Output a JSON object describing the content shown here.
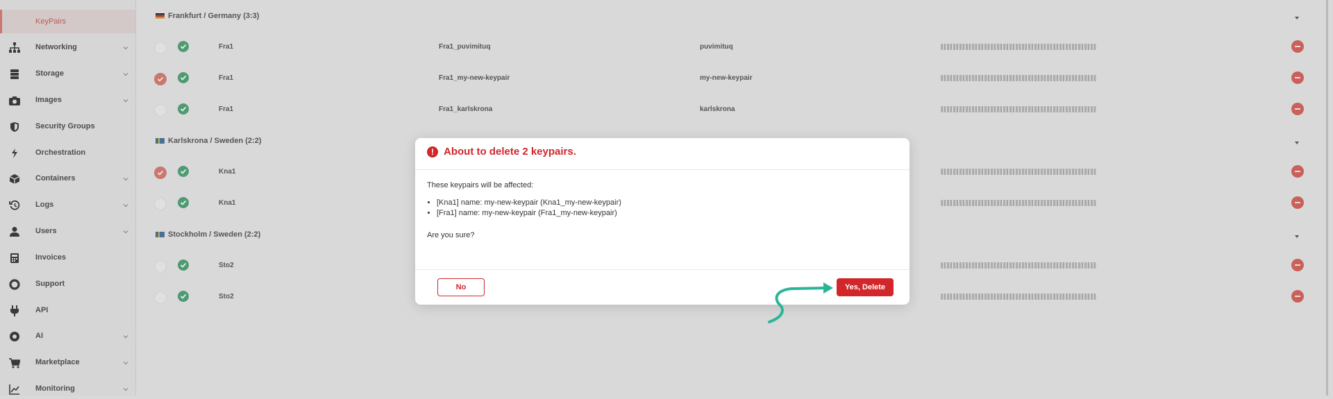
{
  "sidebar": {
    "active": "KeyPairs",
    "items": [
      {
        "label": "Networking",
        "icon": "network-icon",
        "chevron": true
      },
      {
        "label": "Storage",
        "icon": "storage-icon",
        "chevron": true
      },
      {
        "label": "Images",
        "icon": "camera-icon",
        "chevron": true
      },
      {
        "label": "Security Groups",
        "icon": "shield-icon",
        "chevron": false
      },
      {
        "label": "Orchestration",
        "icon": "orchestration-icon",
        "chevron": false
      },
      {
        "label": "Containers",
        "icon": "containers-icon",
        "chevron": true
      },
      {
        "label": "Logs",
        "icon": "history-icon",
        "chevron": true
      },
      {
        "label": "Users",
        "icon": "user-icon",
        "chevron": true
      },
      {
        "label": "Invoices",
        "icon": "invoice-icon",
        "chevron": false
      },
      {
        "label": "Support",
        "icon": "lifebuoy-icon",
        "chevron": false
      },
      {
        "label": "API",
        "icon": "plug-icon",
        "chevron": false
      },
      {
        "label": "AI",
        "icon": "ai-icon",
        "chevron": true
      },
      {
        "label": "Marketplace",
        "icon": "cart-icon",
        "chevron": true
      },
      {
        "label": "Monitoring",
        "icon": "chart-icon",
        "chevron": true
      }
    ]
  },
  "groups": [
    {
      "title": "Frankfurt / Germany (3:3)",
      "flag": "germany-flag-icon",
      "rows": [
        {
          "region": "Fra1",
          "full_name": "Fra1_puvimituq",
          "name": "puvimituq",
          "selected": false
        },
        {
          "region": "Fra1",
          "full_name": "Fra1_my-new-keypair",
          "name": "my-new-keypair",
          "selected": true
        },
        {
          "region": "Fra1",
          "full_name": "Fra1_karlskrona",
          "name": "karlskrona",
          "selected": false
        }
      ]
    },
    {
      "title": "Karlskrona / Sweden (2:2)",
      "flag": "sweden-flag-icon",
      "rows": [
        {
          "region": "Kna1",
          "full_name": "",
          "name": "",
          "selected": true
        },
        {
          "region": "Kna1",
          "full_name": "",
          "name": "",
          "selected": false
        }
      ]
    },
    {
      "title": "Stockholm / Sweden (2:2)",
      "flag": "sweden-flag-icon",
      "rows": [
        {
          "region": "Sto2",
          "full_name": "",
          "name": "",
          "selected": false
        },
        {
          "region": "Sto2",
          "full_name": "",
          "name": "",
          "selected": false
        }
      ]
    }
  ],
  "modal": {
    "title": "About to delete 2 keypairs.",
    "intro": "These keypairs will be affected:",
    "affected": [
      "[Kna1] name: my-new-keypair (Kna1_my-new-keypair)",
      "[Fra1] name: my-new-keypair (Fra1_my-new-keypair)"
    ],
    "confirm": "Are you sure?",
    "no_label": "No",
    "yes_label": "Yes, Delete"
  },
  "colors": {
    "danger": "#d1262a",
    "success": "#4f9a73",
    "annotation_arrow": "#2bb597"
  }
}
